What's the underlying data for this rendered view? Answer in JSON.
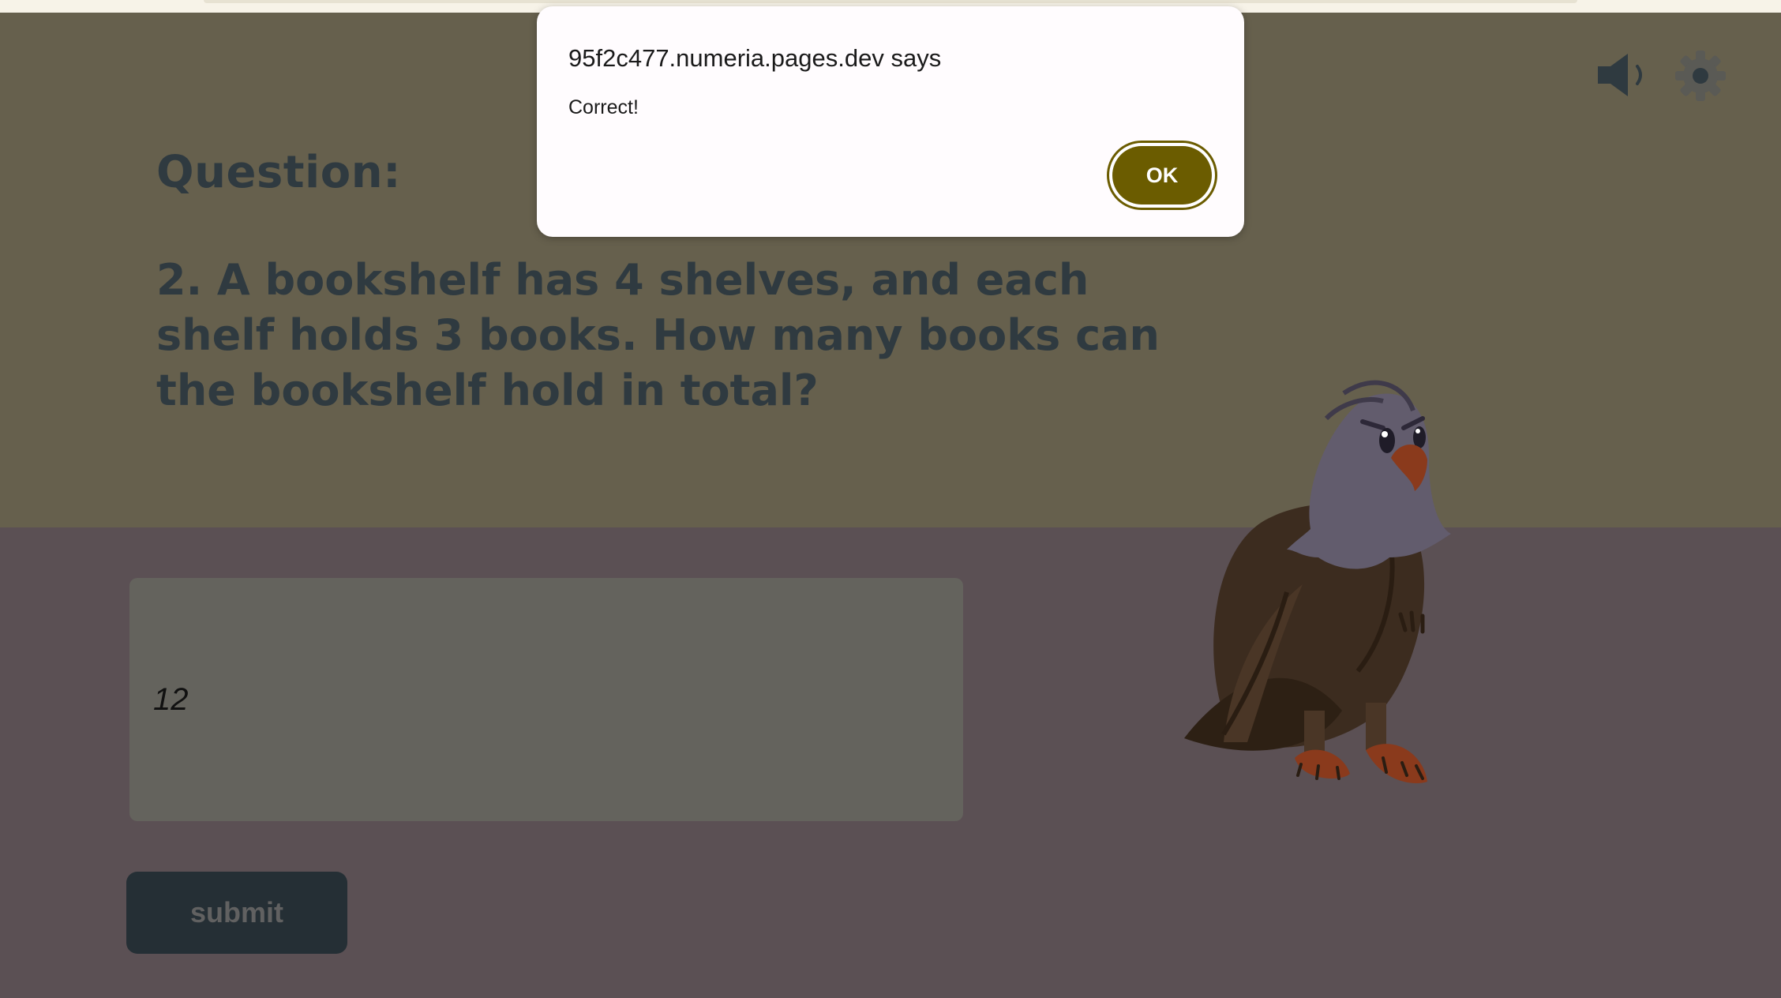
{
  "question": {
    "label": "Question:",
    "text": "2. A bookshelf has 4 shelves, and each shelf holds 3 books. How many books can the bookshelf hold in total?"
  },
  "answer": {
    "value": "12"
  },
  "submit_label": "submit",
  "toolbar": {
    "sound_icon": "speaker-icon",
    "settings_icon": "gear-icon"
  },
  "dialog": {
    "title": "95f2c477.numeria.pages.dev says",
    "message": "Correct!",
    "ok_label": "OK"
  },
  "colors": {
    "hero_bg": "#66604d",
    "lower_bg": "#5b5054",
    "question_text": "#2f3a40",
    "ok_button": "#6b5c00",
    "submit_bg": "#252f35"
  },
  "illustration": "eagle"
}
